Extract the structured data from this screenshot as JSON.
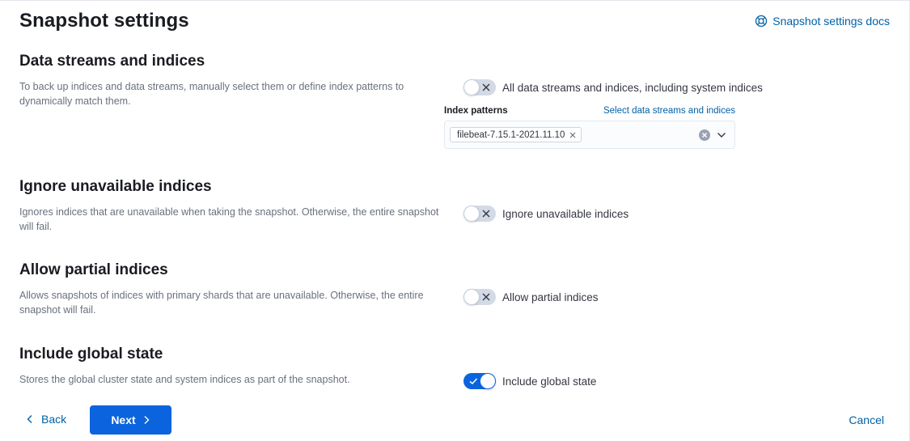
{
  "page": {
    "title": "Snapshot settings",
    "docs_link": "Snapshot settings docs"
  },
  "sections": {
    "data_streams": {
      "title": "Data streams and indices",
      "description": "To back up indices and data streams, manually select them or define index patterns to dynamically match them.",
      "toggle_label": "All data streams and indices, including system indices",
      "toggle_on": false,
      "index_patterns_label": "Index patterns",
      "select_link": "Select data streams and indices",
      "selected_patterns": [
        "filebeat-7.15.1-2021.11.10"
      ]
    },
    "ignore_unavailable": {
      "title": "Ignore unavailable indices",
      "description": "Ignores indices that are unavailable when taking the snapshot. Otherwise, the entire snapshot will fail.",
      "toggle_label": "Ignore unavailable indices",
      "toggle_on": false
    },
    "allow_partial": {
      "title": "Allow partial indices",
      "description": "Allows snapshots of indices with primary shards that are unavailable. Otherwise, the entire snapshot will fail.",
      "toggle_label": "Allow partial indices",
      "toggle_on": false
    },
    "global_state": {
      "title": "Include global state",
      "description": "Stores the global cluster state and system indices as part of the snapshot.",
      "toggle_label": "Include global state",
      "toggle_on": true
    }
  },
  "footer": {
    "back_label": "Back",
    "next_label": "Next",
    "cancel_label": "Cancel"
  },
  "colors": {
    "primary": "#0b64dd",
    "link": "#0061a6",
    "toggle_off": "#d3dae6"
  },
  "icons": {
    "docs": "lifebuoy-icon",
    "toggle_off": "cross-icon",
    "toggle_on": "check-icon",
    "pill_remove": "cross-icon",
    "combo_clear": "clear-circle-icon",
    "combo_open": "chevron-down-icon",
    "back": "chevron-left-icon",
    "next": "chevron-right-icon"
  }
}
